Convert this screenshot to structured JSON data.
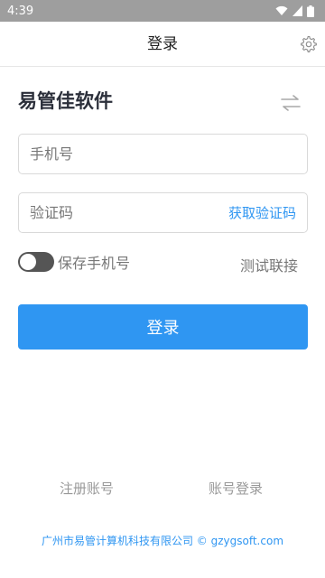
{
  "status_bar": {
    "time": "4:39",
    "icons": [
      "wifi-icon",
      "cellular-signal-icon",
      "battery-icon"
    ]
  },
  "app_bar": {
    "title": "登录",
    "settings_icon": "gear-icon"
  },
  "brand": {
    "title": "易管佳软件",
    "switch_icon": "swap-arrows-icon"
  },
  "form": {
    "phone_placeholder": "手机号",
    "phone_value": "",
    "code_placeholder": "验证码",
    "code_value": "",
    "get_code_label": "获取验证码",
    "remember_label": "保存手机号",
    "remember_on": false,
    "test_label": "测试联接",
    "login_label": "登录"
  },
  "links": {
    "register_label": "注册账号",
    "account_login_label": "账号登录"
  },
  "footer": {
    "text": "广州市易管计算机科技有限公司 © gzygsoft.com"
  },
  "colors": {
    "accent": "#2f96f2",
    "status_bar": "#9e9e9e",
    "muted_text": "#777777"
  }
}
